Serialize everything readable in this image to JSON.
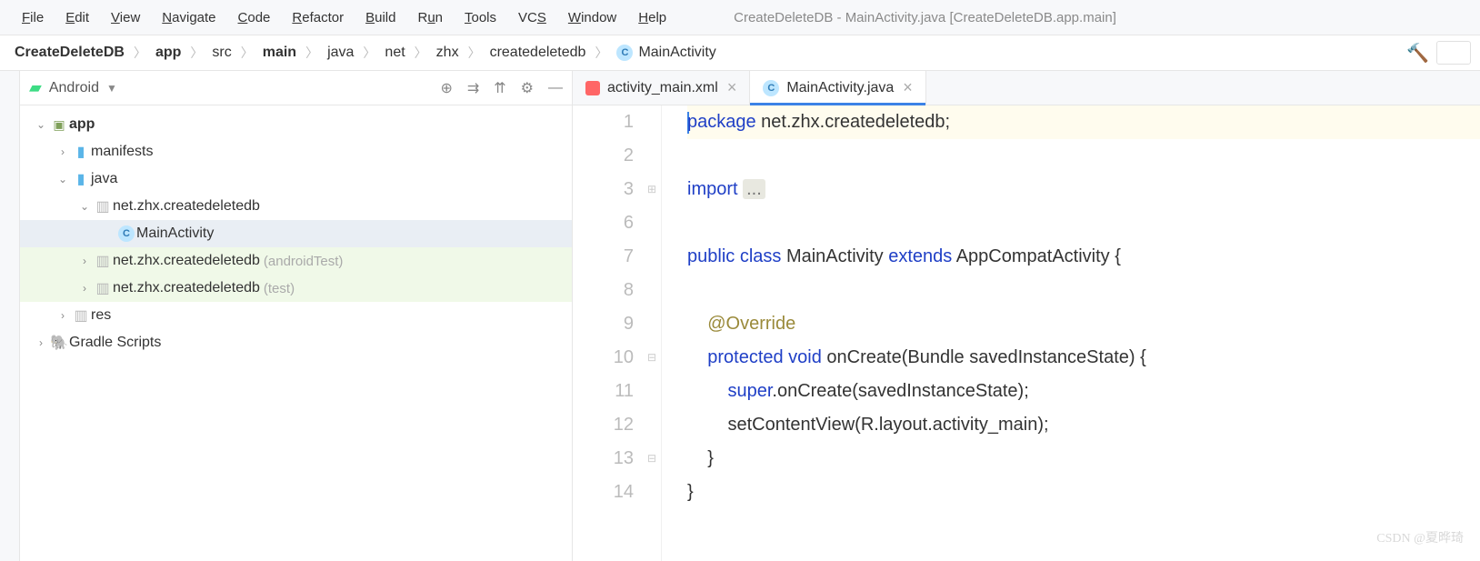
{
  "menu": {
    "items": [
      "File",
      "Edit",
      "View",
      "Navigate",
      "Code",
      "Refactor",
      "Build",
      "Run",
      "Tools",
      "VCS",
      "Window",
      "Help"
    ]
  },
  "windowTitle": "CreateDeleteDB - MainActivity.java [CreateDeleteDB.app.main]",
  "breadcrumbs": {
    "items": [
      {
        "label": "CreateDeleteDB",
        "bold": true
      },
      {
        "label": "app",
        "bold": true
      },
      {
        "label": "src",
        "bold": false
      },
      {
        "label": "main",
        "bold": true
      },
      {
        "label": "java",
        "bold": false
      },
      {
        "label": "net",
        "bold": false
      },
      {
        "label": "zhx",
        "bold": false
      },
      {
        "label": "createdeletedb",
        "bold": false
      }
    ],
    "leaf": "MainActivity"
  },
  "projectPane": {
    "title": "Android",
    "tree": {
      "app": "app",
      "manifests": "manifests",
      "java": "java",
      "pkg_main": "net.zhx.createdeletedb",
      "main_activity": "MainActivity",
      "pkg_androidTest": "net.zhx.createdeletedb",
      "suffix_androidTest": "(androidTest)",
      "pkg_test": "net.zhx.createdeletedb",
      "suffix_test": "(test)",
      "res": "res",
      "gradle": "Gradle Scripts"
    }
  },
  "tabs": [
    {
      "label": "activity_main.xml",
      "type": "xml",
      "active": false
    },
    {
      "label": "MainActivity.java",
      "type": "class",
      "active": true
    }
  ],
  "code": {
    "lineNumbers": [
      "1",
      "2",
      "3",
      "6",
      "7",
      "8",
      "9",
      "10",
      "11",
      "12",
      "13",
      "14"
    ],
    "lines": {
      "l1a": "ackage",
      "l1b": " net.zhx.createdeletedb;",
      "l3a": "import ",
      "l3b": "...",
      "l7a": "public class",
      "l7b": " MainActivity ",
      "l7c": "extends",
      "l7d": " AppCompatActivity {",
      "l9": "    @Override",
      "l10a": "    ",
      "l10b": "protected void",
      "l10c": " onCreate(Bundle savedInstanceState) {",
      "l11a": "        ",
      "l11b": "super",
      "l11c": ".onCreate(savedInstanceState);",
      "l12": "        setContentView(R.layout.activity_main);",
      "l13": "    }",
      "l14": "}"
    }
  },
  "watermark": "CSDN @夏晔琦"
}
